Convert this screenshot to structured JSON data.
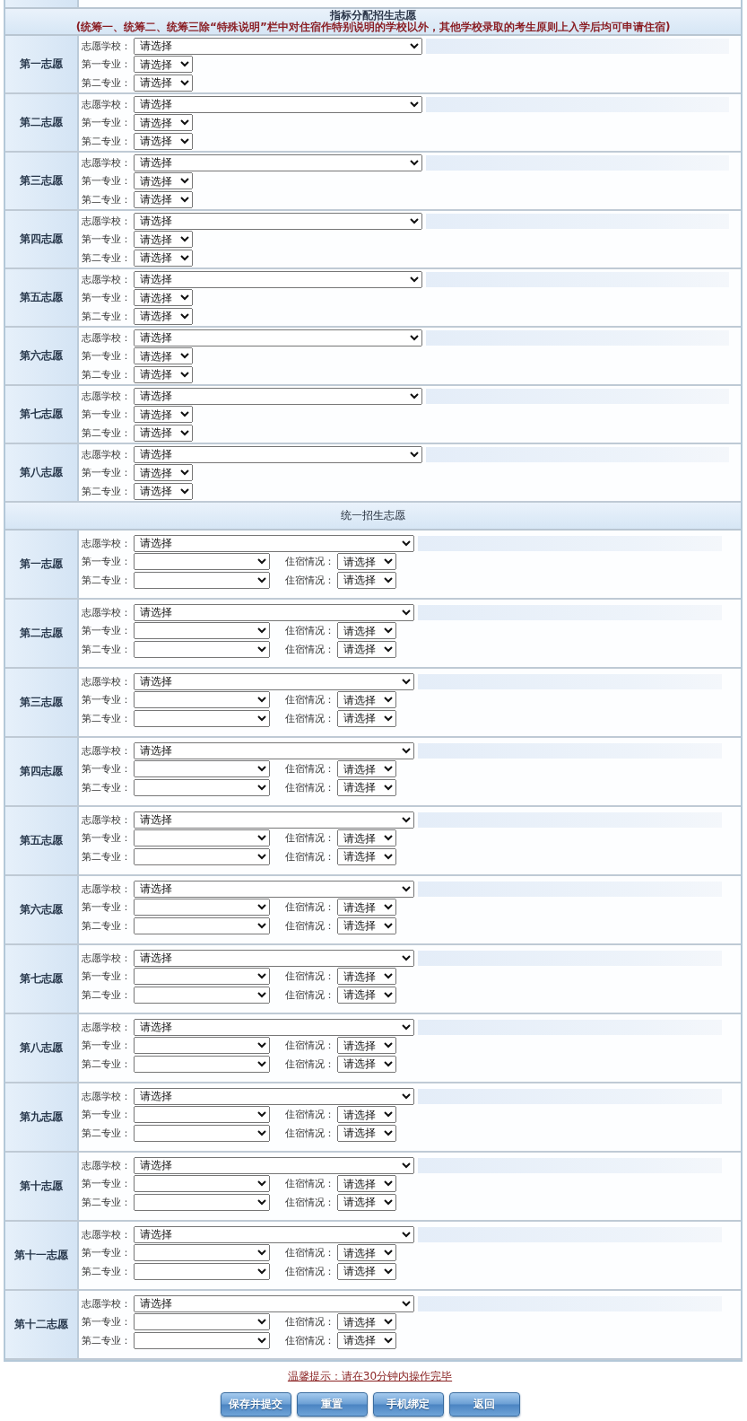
{
  "sections": [
    {
      "kind": "quota",
      "title": "指标分配招生志愿",
      "note": "(统筹一、统筹二、统筹三除“特殊说明”栏中对住宿作特别说明的学校以外，其他学校录取的考生原则上入学后均可申请住宿)",
      "choices": [
        {
          "label": "第一志愿",
          "school": {
            "label": "志愿学校：",
            "value": "请选择"
          },
          "majors": [
            {
              "label": "第一专业：",
              "value": "请选择"
            },
            {
              "label": "第二专业：",
              "value": "请选择"
            }
          ]
        },
        {
          "label": "第二志愿",
          "school": {
            "label": "志愿学校：",
            "value": "请选择"
          },
          "majors": [
            {
              "label": "第一专业：",
              "value": "请选择"
            },
            {
              "label": "第二专业：",
              "value": "请选择"
            }
          ]
        },
        {
          "label": "第三志愿",
          "school": {
            "label": "志愿学校：",
            "value": "请选择"
          },
          "majors": [
            {
              "label": "第一专业：",
              "value": "请选择"
            },
            {
              "label": "第二专业：",
              "value": "请选择"
            }
          ]
        },
        {
          "label": "第四志愿",
          "school": {
            "label": "志愿学校：",
            "value": "请选择"
          },
          "majors": [
            {
              "label": "第一专业：",
              "value": "请选择"
            },
            {
              "label": "第二专业：",
              "value": "请选择"
            }
          ]
        },
        {
          "label": "第五志愿",
          "school": {
            "label": "志愿学校：",
            "value": "请选择"
          },
          "majors": [
            {
              "label": "第一专业：",
              "value": "请选择"
            },
            {
              "label": "第二专业：",
              "value": "请选择"
            }
          ]
        },
        {
          "label": "第六志愿",
          "school": {
            "label": "志愿学校：",
            "value": "请选择"
          },
          "majors": [
            {
              "label": "第一专业：",
              "value": "请选择"
            },
            {
              "label": "第二专业：",
              "value": "请选择"
            }
          ]
        },
        {
          "label": "第七志愿",
          "school": {
            "label": "志愿学校：",
            "value": "请选择"
          },
          "majors": [
            {
              "label": "第一专业：",
              "value": "请选择"
            },
            {
              "label": "第二专业：",
              "value": "请选择"
            }
          ]
        },
        {
          "label": "第八志愿",
          "school": {
            "label": "志愿学校：",
            "value": "请选择"
          },
          "majors": [
            {
              "label": "第一专业：",
              "value": "请选择"
            },
            {
              "label": "第二专业：",
              "value": "请选择"
            }
          ]
        }
      ]
    },
    {
      "kind": "unified",
      "title": "统一招生志愿",
      "choices": [
        {
          "label": "第一志愿",
          "school": {
            "label": "志愿学校：",
            "value": "请选择"
          },
          "majors": [
            {
              "label": "第一专业：",
              "housing": {
                "label": "住宿情况：",
                "value": "请选择"
              }
            },
            {
              "label": "第二专业：",
              "housing": {
                "label": "住宿情况：",
                "value": "请选择"
              }
            }
          ]
        },
        {
          "label": "第二志愿",
          "school": {
            "label": "志愿学校：",
            "value": "请选择"
          },
          "majors": [
            {
              "label": "第一专业：",
              "housing": {
                "label": "住宿情况：",
                "value": "请选择"
              }
            },
            {
              "label": "第二专业：",
              "housing": {
                "label": "住宿情况：",
                "value": "请选择"
              }
            }
          ]
        },
        {
          "label": "第三志愿",
          "school": {
            "label": "志愿学校：",
            "value": "请选择"
          },
          "majors": [
            {
              "label": "第一专业：",
              "housing": {
                "label": "住宿情况：",
                "value": "请选择"
              }
            },
            {
              "label": "第二专业：",
              "housing": {
                "label": "住宿情况：",
                "value": "请选择"
              }
            }
          ]
        },
        {
          "label": "第四志愿",
          "school": {
            "label": "志愿学校：",
            "value": "请选择"
          },
          "majors": [
            {
              "label": "第一专业：",
              "housing": {
                "label": "住宿情况：",
                "value": "请选择"
              }
            },
            {
              "label": "第二专业：",
              "housing": {
                "label": "住宿情况：",
                "value": "请选择"
              }
            }
          ]
        },
        {
          "label": "第五志愿",
          "school": {
            "label": "志愿学校：",
            "value": "请选择"
          },
          "majors": [
            {
              "label": "第一专业：",
              "housing": {
                "label": "住宿情况：",
                "value": "请选择"
              }
            },
            {
              "label": "第二专业：",
              "housing": {
                "label": "住宿情况：",
                "value": "请选择"
              }
            }
          ]
        },
        {
          "label": "第六志愿",
          "school": {
            "label": "志愿学校：",
            "value": "请选择"
          },
          "majors": [
            {
              "label": "第一专业：",
              "housing": {
                "label": "住宿情况：",
                "value": "请选择"
              }
            },
            {
              "label": "第二专业：",
              "housing": {
                "label": "住宿情况：",
                "value": "请选择"
              }
            }
          ]
        },
        {
          "label": "第七志愿",
          "school": {
            "label": "志愿学校：",
            "value": "请选择"
          },
          "majors": [
            {
              "label": "第一专业：",
              "housing": {
                "label": "住宿情况：",
                "value": "请选择"
              }
            },
            {
              "label": "第二专业：",
              "housing": {
                "label": "住宿情况：",
                "value": "请选择"
              }
            }
          ]
        },
        {
          "label": "第八志愿",
          "school": {
            "label": "志愿学校：",
            "value": "请选择"
          },
          "majors": [
            {
              "label": "第一专业：",
              "housing": {
                "label": "住宿情况：",
                "value": "请选择"
              }
            },
            {
              "label": "第二专业：",
              "housing": {
                "label": "住宿情况：",
                "value": "请选择"
              }
            }
          ]
        },
        {
          "label": "第九志愿",
          "school": {
            "label": "志愿学校：",
            "value": "请选择"
          },
          "majors": [
            {
              "label": "第一专业：",
              "housing": {
                "label": "住宿情况：",
                "value": "请选择"
              }
            },
            {
              "label": "第二专业：",
              "housing": {
                "label": "住宿情况：",
                "value": "请选择"
              }
            }
          ]
        },
        {
          "label": "第十志愿",
          "school": {
            "label": "志愿学校：",
            "value": "请选择"
          },
          "majors": [
            {
              "label": "第一专业：",
              "housing": {
                "label": "住宿情况：",
                "value": "请选择"
              }
            },
            {
              "label": "第二专业：",
              "housing": {
                "label": "住宿情况：",
                "value": "请选择"
              }
            }
          ]
        },
        {
          "label": "第十一志愿",
          "school": {
            "label": "志愿学校：",
            "value": "请选择"
          },
          "majors": [
            {
              "label": "第一专业：",
              "housing": {
                "label": "住宿情况：",
                "value": "请选择"
              }
            },
            {
              "label": "第二专业：",
              "housing": {
                "label": "住宿情况：",
                "value": "请选择"
              }
            }
          ]
        },
        {
          "label": "第十二志愿",
          "school": {
            "label": "志愿学校：",
            "value": "请选择"
          },
          "majors": [
            {
              "label": "第一专业：",
              "housing": {
                "label": "住宿情况：",
                "value": "请选择"
              }
            },
            {
              "label": "第二专业：",
              "housing": {
                "label": "住宿情况：",
                "value": "请选择"
              }
            }
          ]
        }
      ]
    }
  ],
  "tip": "温馨提示：请在30分钟内操作完毕",
  "buttons": [
    "保存并提交",
    "重置",
    "手机绑定",
    "返回"
  ]
}
